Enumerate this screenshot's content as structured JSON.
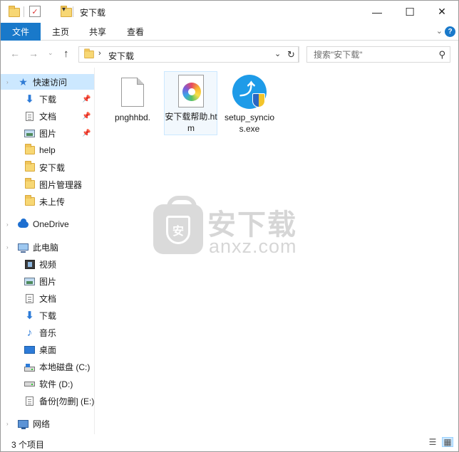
{
  "window": {
    "title": "安下载",
    "controls": {
      "minimize": "—",
      "maximize": "☐",
      "close": "✕"
    }
  },
  "ribbon": {
    "file_tab": "文件",
    "tabs": [
      "主页",
      "共享",
      "查看"
    ],
    "help": "?"
  },
  "address": {
    "path": "安下载",
    "separator": "›",
    "dropdown": "⌄",
    "refresh": "↻"
  },
  "search": {
    "placeholder": "搜索\"安下载\"",
    "icon": "⚲"
  },
  "nav": {
    "quick_access": {
      "label": "快速访问",
      "items": [
        {
          "label": "下载",
          "pinned": true
        },
        {
          "label": "文档",
          "pinned": true
        },
        {
          "label": "图片",
          "pinned": true
        },
        {
          "label": "help",
          "pinned": false
        },
        {
          "label": "安下载",
          "pinned": false
        },
        {
          "label": "图片管理器",
          "pinned": false
        },
        {
          "label": "未上传",
          "pinned": false
        }
      ]
    },
    "onedrive": "OneDrive",
    "this_pc": {
      "label": "此电脑",
      "items": [
        "视频",
        "图片",
        "文档",
        "下载",
        "音乐",
        "桌面",
        "本地磁盘 (C:)",
        "软件 (D:)",
        "备份[勿删] (E:)"
      ]
    },
    "network": "网络"
  },
  "files": [
    {
      "name": "pnghhbd.",
      "type": "blank"
    },
    {
      "name": "安下载帮助.htm",
      "type": "htm"
    },
    {
      "name": "setup_syncios.exe",
      "type": "exe"
    }
  ],
  "watermark": {
    "cn": "安下载",
    "en": "anxz.com",
    "badge": "安"
  },
  "status": {
    "count": "3 个项目"
  }
}
